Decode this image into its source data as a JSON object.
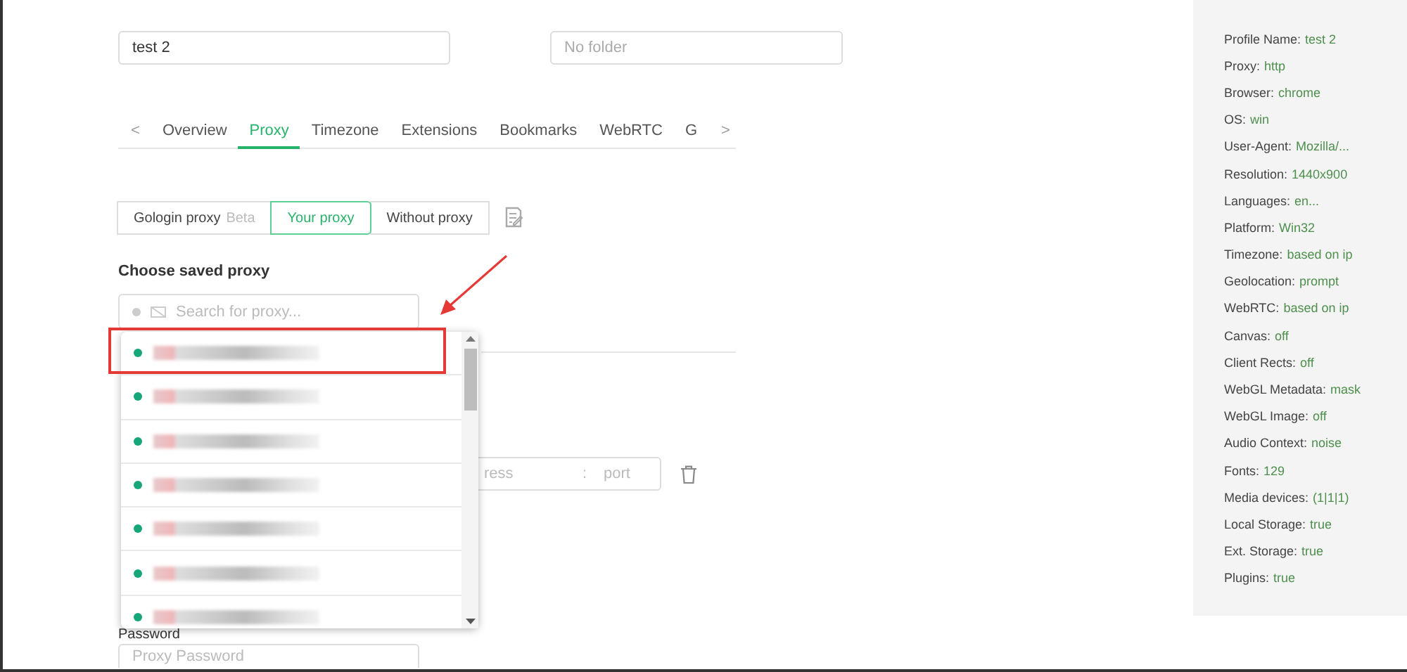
{
  "profile": {
    "name_value": "test 2",
    "folder_placeholder": "No folder"
  },
  "tabs": {
    "prev": "<",
    "next": ">",
    "items": [
      {
        "label": "Overview",
        "selected": false
      },
      {
        "label": "Proxy",
        "selected": true
      },
      {
        "label": "Timezone",
        "selected": false
      },
      {
        "label": "Extensions",
        "selected": false
      },
      {
        "label": "Bookmarks",
        "selected": false
      },
      {
        "label": "WebRTC",
        "selected": false
      },
      {
        "label": "G",
        "selected": false
      }
    ]
  },
  "proxy_modes": [
    {
      "label": "Gologin proxy",
      "badge": "Beta",
      "selected": false
    },
    {
      "label": "Your proxy",
      "selected": true
    },
    {
      "label": "Without proxy",
      "selected": false
    }
  ],
  "saved_proxy": {
    "heading": "Choose saved proxy",
    "placeholder": "Search for proxy...",
    "rows": [
      {
        "annotated": true
      },
      {
        "annotated": false
      },
      {
        "annotated": false
      },
      {
        "annotated": false
      },
      {
        "annotated": false
      },
      {
        "annotated": false
      },
      {
        "annotated": false
      }
    ]
  },
  "address_field": {
    "host_placeholder": "ress",
    "separator": ":",
    "port_placeholder": "port"
  },
  "password": {
    "label": "Password",
    "placeholder": "Proxy Password"
  },
  "summary": [
    {
      "label": "Profile Name:",
      "value": "test 2"
    },
    {
      "label": "Proxy:",
      "value": "http"
    },
    {
      "label": "Browser:",
      "value": "chrome"
    },
    {
      "label": "OS:",
      "value": "win"
    },
    {
      "label": "User-Agent:",
      "value": "Mozilla/..."
    },
    {
      "label": "Resolution:",
      "value": "1440x900"
    },
    {
      "label": "Languages:",
      "value": "en..."
    },
    {
      "label": "Platform:",
      "value": "Win32"
    },
    {
      "label": "Timezone:",
      "value": "based on ip"
    },
    {
      "label": "Geolocation:",
      "value": "prompt"
    },
    {
      "label": "WebRTC:",
      "value": "based on ip"
    },
    {
      "label": "Canvas:",
      "value": "off"
    },
    {
      "label": "Client Rects:",
      "value": "off"
    },
    {
      "label": "WebGL Metadata:",
      "value": "mask"
    },
    {
      "label": "WebGL Image:",
      "value": "off"
    },
    {
      "label": "Audio Context:",
      "value": "noise"
    },
    {
      "label": "Fonts:",
      "value": "129"
    },
    {
      "label": "Media devices:",
      "value": "(1|1|1)"
    },
    {
      "label": "Local Storage:",
      "value": "true"
    },
    {
      "label": "Ext. Storage:",
      "value": "true"
    },
    {
      "label": "Plugins:",
      "value": "true"
    }
  ]
}
